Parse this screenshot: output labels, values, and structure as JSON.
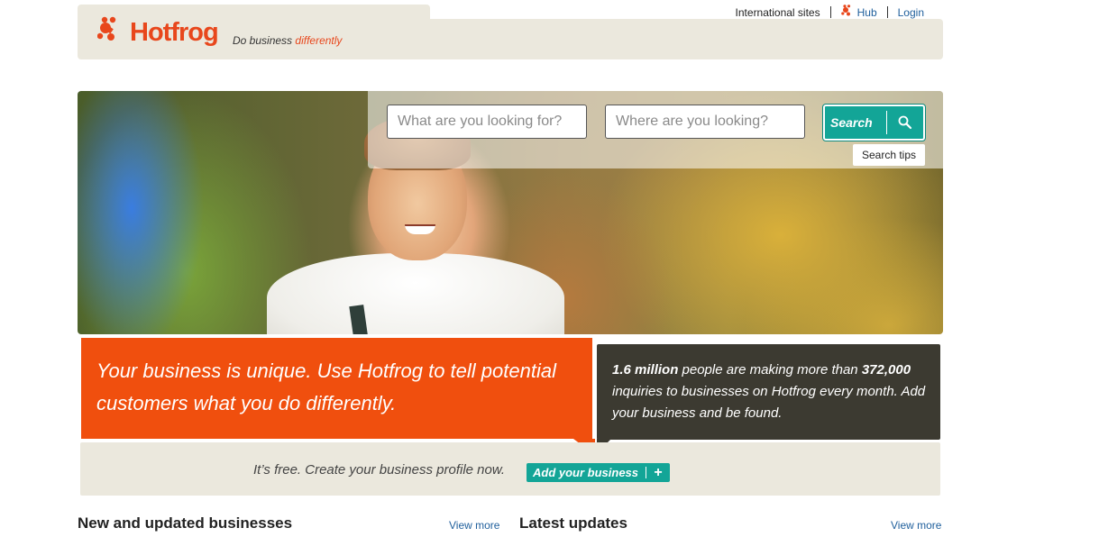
{
  "brand": {
    "logo_text_main": "Hotfrog",
    "tagline_plain": "Do business",
    "tagline_accent": "differently",
    "accent_color": "#e8471c",
    "logo_icon": "frog-paw-icon"
  },
  "top_nav": {
    "international": "International sites",
    "hub": "Hub",
    "login": "Login"
  },
  "search": {
    "what_placeholder": "What are you looking for?",
    "where_placeholder": "Where are you looking?",
    "button_label": "Search",
    "button_icon": "magnifier-icon",
    "tips_label": "Search tips",
    "button_color": "#13a597"
  },
  "promo": {
    "headline": "Your business is unique. Use Hotfrog to tell potential customers what you do differently.",
    "stat_people": "1.6 million",
    "stat_text1": " people are making more than ",
    "stat_inquiries": "372,000",
    "stat_text2": " inquiries to businesses on Hotfrog every month. Add your business and be found.",
    "cta_text": "It’s free. Create your business profile now.",
    "add_button": "Add your business",
    "add_icon": "plus-icon",
    "orange_color": "#f04f0e",
    "dark_color": "#3c3a31"
  },
  "sections": {
    "new_title": "New and updated businesses",
    "new_more": "View more",
    "latest_title": "Latest updates",
    "latest_more": "View more"
  }
}
